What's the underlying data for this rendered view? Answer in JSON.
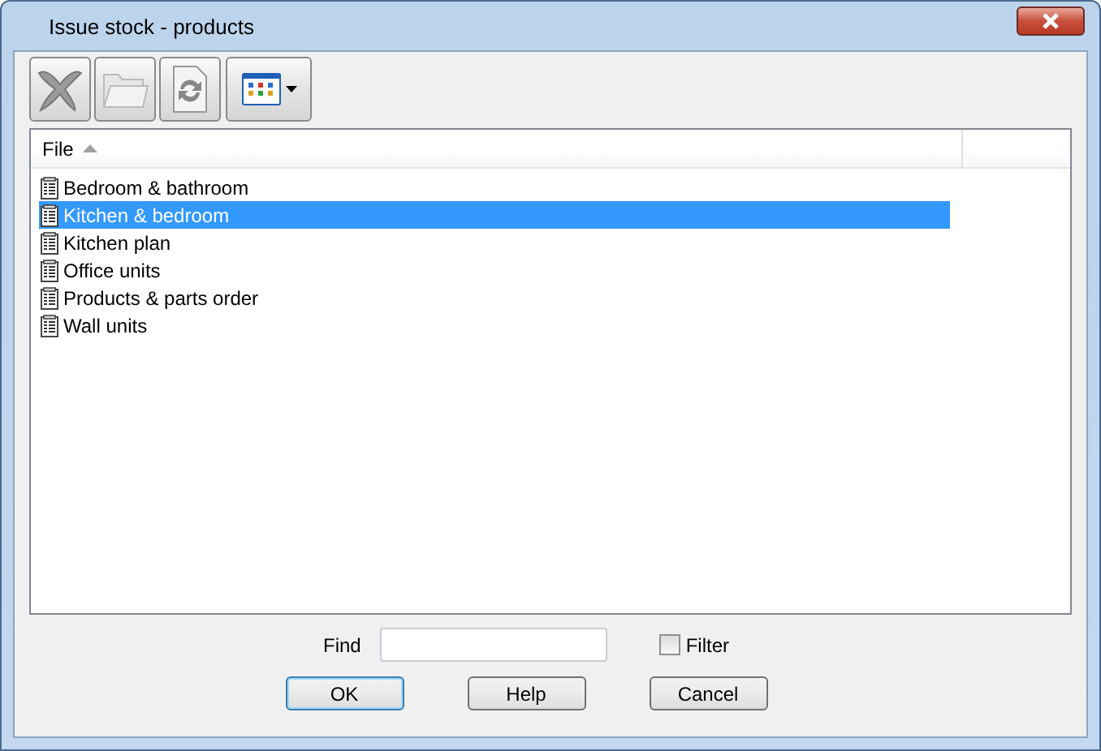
{
  "window": {
    "title": "Issue stock - products"
  },
  "table": {
    "columns": [
      {
        "label": "File",
        "sorted_ascending": true
      }
    ],
    "rows": [
      {
        "label": "Bedroom & bathroom",
        "selected": false
      },
      {
        "label": "Kitchen & bedroom",
        "selected": true
      },
      {
        "label": "Kitchen plan",
        "selected": false
      },
      {
        "label": "Office units",
        "selected": false
      },
      {
        "label": "Products & parts order",
        "selected": false
      },
      {
        "label": "Wall units",
        "selected": false
      }
    ]
  },
  "find": {
    "label": "Find"
  },
  "filter": {
    "label": "Filter",
    "checked": false
  },
  "buttons": [
    {
      "label": "OK",
      "default": true
    },
    {
      "label": "Help",
      "default": false
    },
    {
      "label": "Cancel",
      "default": false
    }
  ]
}
